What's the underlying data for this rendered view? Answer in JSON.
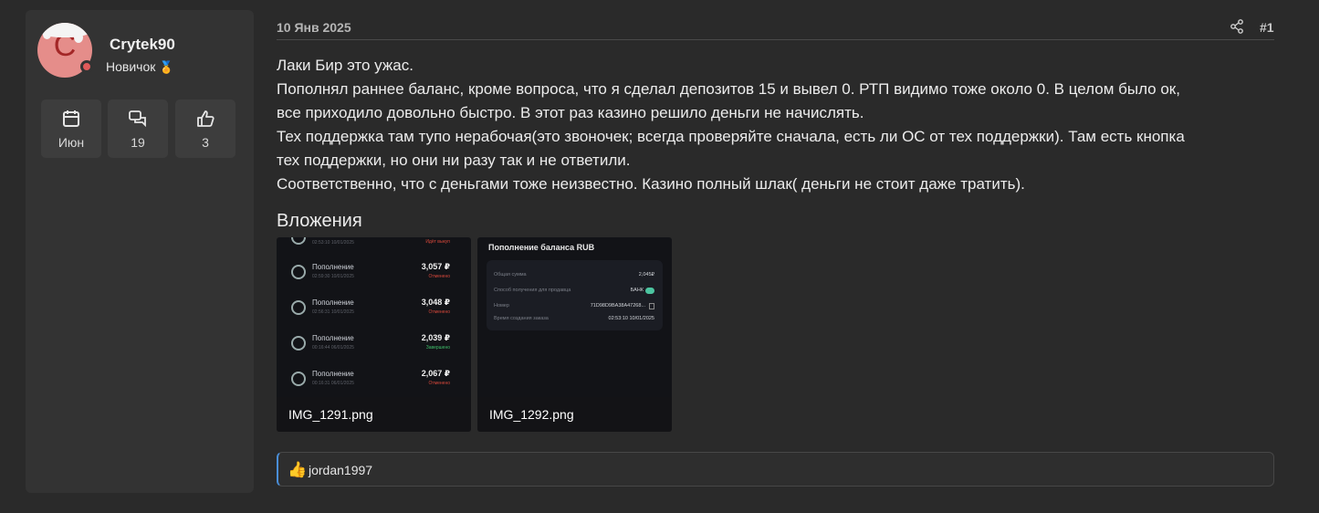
{
  "user": {
    "avatar_letter": "C",
    "name": "Crytek90",
    "title": "Новичок",
    "medal_icon": "medal-icon",
    "stats": [
      {
        "icon": "calendar-icon",
        "value": "Июн"
      },
      {
        "icon": "messages-icon",
        "value": "19"
      },
      {
        "icon": "thumbs-up-icon",
        "value": "3"
      }
    ]
  },
  "message": {
    "date": "10 Янв 2025",
    "post_number": "#1",
    "share_icon": "share-icon",
    "lines": [
      "Лаки Бир это ужас.",
      "Пополнял раннее баланс, кроме вопроса, что я сделал депозитов 15 и вывел 0. РТП видимо тоже около 0. В целом было ок,",
      "все приходило довольно быстро. В этот раз казино решило деньги не начислять.",
      "Тех поддержка там тупо нерабочая(это звоночек; всегда проверяйте сначала, есть ли ОС от тех поддержки). Там есть кнопка",
      "тех поддержки, но они ни разу так и не ответили.",
      "Соответственно, что с деньгами тоже неизвестно. Казино полный шлак( деньги не стоит даже тратить)."
    ]
  },
  "attachments": {
    "title": "Вложения",
    "items": [
      {
        "filename": "IMG_1291.png",
        "top_status": "Идёт выкуп",
        "transactions": [
          {
            "label": "Пополнение",
            "time": "02:59:30 10/01/2025",
            "amount": "3,057 ₽",
            "status": "Отменено",
            "status_color": "#d9483b"
          },
          {
            "label": "Пополнение",
            "time": "02:56:31 10/01/2025",
            "amount": "3,048 ₽",
            "status": "Отменено",
            "status_color": "#d9483b"
          },
          {
            "label": "Пополнение",
            "time": "00:16:44 06/01/2025",
            "amount": "2,039 ₽",
            "status": "Завершено",
            "status_color": "#3fbf6a"
          },
          {
            "label": "Пополнение",
            "time": "00:16:31 06/01/2025",
            "amount": "2,067 ₽",
            "status": "Отменено",
            "status_color": "#d9483b"
          }
        ]
      },
      {
        "filename": "IMG_1292.png",
        "heading": "Пополнение баланса RUB",
        "rows": [
          {
            "label": "Общая сумма",
            "value": "2,045₽"
          },
          {
            "label": "Способ получения для продавца",
            "value": "БАНК"
          },
          {
            "label": "Номер",
            "value": "71D98D9BA38A47268..."
          },
          {
            "label": "Время создания заказа",
            "value": "02:53:10 10/01/2025"
          }
        ]
      }
    ]
  },
  "reactions": {
    "icon": "thumbs-up-icon",
    "users": "jordan1997"
  }
}
